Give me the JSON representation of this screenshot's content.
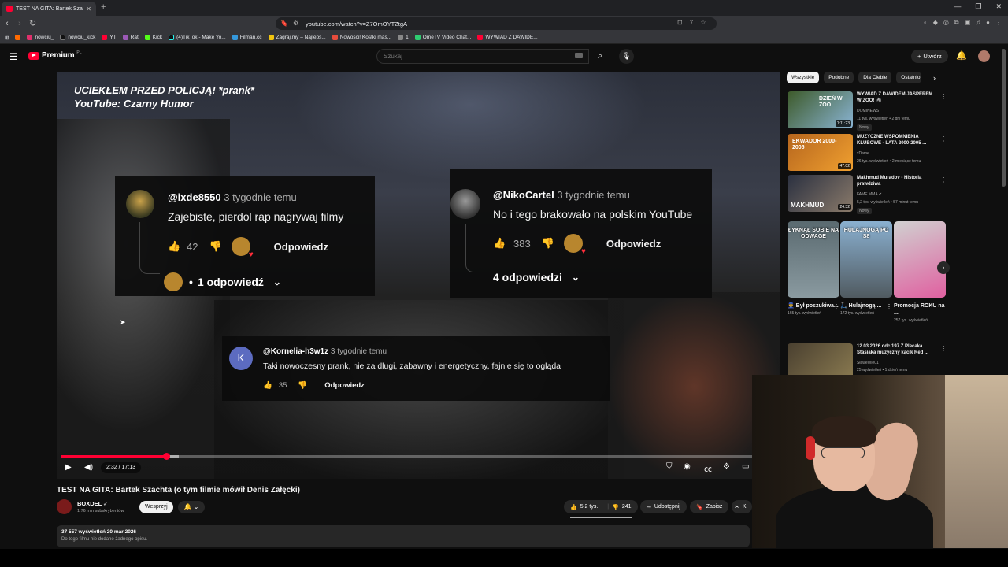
{
  "browser": {
    "tab_title": "TEST NA GITA: Bartek Szachta (o",
    "url": "youtube.com/watch?v=Z7OmOYTZtgA",
    "bookmarks": [
      {
        "label": "nowciu_",
        "color": "#e1306c"
      },
      {
        "label": "nowciu_kick",
        "color": "#111111"
      },
      {
        "label": "YT",
        "color": "#ff0033"
      },
      {
        "label": "Rat",
        "color": "#9b59b6"
      },
      {
        "label": "Kick",
        "color": "#53fc18"
      },
      {
        "label": "(4)TikTok - Make Yo...",
        "color": "#111111"
      },
      {
        "label": "Filman.cc",
        "color": "#3498db"
      },
      {
        "label": "Zagraj.my – Najleps...",
        "color": "#f1c40f"
      },
      {
        "label": "Nowości! Kostki mas...",
        "color": "#e74c3c"
      },
      {
        "label": "1",
        "color": "#888888"
      },
      {
        "label": "OmeTV Video Chat...",
        "color": "#2ecc71"
      },
      {
        "label": "WYWIAD Z DAWIDE...",
        "color": "#ff0033"
      }
    ]
  },
  "youtube": {
    "logo_text": "Premium",
    "logo_region": "PL",
    "search_placeholder": "Szukaj",
    "create_label": "Utwórz"
  },
  "video": {
    "overlay_title_1": "UCIEKŁEM PRZED POLICJĄ! *prank*",
    "overlay_title_2": "YouTube: Czarny Humor",
    "time": "2:32 / 17:13",
    "progress_fraction": 0.147,
    "buffered_fraction": 0.165,
    "comments": [
      {
        "user": "@ixde8550",
        "when": "3 tygodnie temu",
        "text": "Zajebiste, pierdol rap nagrywaj filmy",
        "likes": "42",
        "reply_label": "Odpowiedz",
        "replies": "1 odpowiedź"
      },
      {
        "user": "@NikoCartel",
        "when": "3 tygodnie temu",
        "text": "No i tego brakowało na polskim YouTube",
        "likes": "383",
        "reply_label": "Odpowiedz",
        "replies": "4 odpowiedzi"
      },
      {
        "user": "@Kornelia-h3w1z",
        "when": "3 tygodnie temu",
        "text": "Taki nowoczesny prank, nie za dlugi, zabawny i energetyczny, fajnie się to ogląda",
        "likes": "35",
        "reply_label": "Odpowiedz",
        "avatar_letter": "K"
      }
    ]
  },
  "below": {
    "title": "TEST NA GITA: Bartek Szachta (o tym filmie mówił Denis Załęcki)",
    "channel": "BOXDEL",
    "subs": "1,76 mln subskrybentów",
    "support": "Wesprzyj",
    "likes": "5,2 tys.",
    "dislikes": "241",
    "share": "Udostępnij",
    "save": "Zapisz",
    "clip": "K",
    "views_date": "37 557 wyświetleń  20 mar 2026",
    "desc": "Do tego filmu nie dodano żadnego opisu."
  },
  "sidebar": {
    "chips": [
      "Wszystkie",
      "Podobne",
      "Dla Ciebie",
      "Ostatnio"
    ],
    "recs": [
      {
        "title": "WYWIAD Z DAWIDEM JASPEREM W ZOO! 🦓",
        "channel": "DOMINEWS",
        "views": "11 tys. wyświetleń • 2 dni temu",
        "badge": "Nowy",
        "duration": "1:11:23",
        "thumb_text": "DZIEŃ W ZOO"
      },
      {
        "title": "MUZYCZNE WSPOMNIENIA KLUBOWE - LATA 2000-2005 ...",
        "channel": "xDame",
        "views": "26 tys. wyświetleń • 2 miesiące temu",
        "badge": "",
        "duration": "47:02",
        "thumb_text": "EKWADOR 2000-2005"
      },
      {
        "title": "Makhmud Muradov - Historia prawdziwa",
        "channel": "FAME MMA",
        "views": "5,2 tys. wyświetleń • 57 minut temu",
        "badge": "Nowy",
        "duration": "24:32",
        "thumb_text": "MAKHMUD"
      },
      {
        "title": "12.03.2026 odc.197 Z Plecaka Stasiaka muzyczny kącik Red ...",
        "channel": "SławeWie01",
        "views": "25 wyświetleń • 1 dzień temu",
        "badge": "",
        "duration": "",
        "thumb_text": ""
      }
    ],
    "shorts": [
      {
        "title": "Był poszukiwa...",
        "views": "165 tys. wyświetleń",
        "caption": "ŁYKNĄŁ SOBIE NA ODWAGĘ",
        "icon": "👮"
      },
      {
        "title": "Hulajnogą ...",
        "views": "172 tys. wyświetleń",
        "caption": "HULAJNOGĄ PO S8",
        "icon": "🛴"
      },
      {
        "title": "Promocja ROKU na ...",
        "views": "257 tys. wyświetleń",
        "caption": "",
        "icon": ""
      }
    ]
  }
}
